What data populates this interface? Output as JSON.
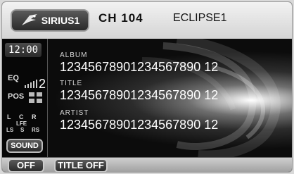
{
  "header": {
    "source_button": {
      "label": "SIRIUS1",
      "icon": "sirius-dog-icon"
    },
    "channel": "CH 104",
    "channel_name": "ECLIPSE1"
  },
  "sidebar": {
    "clock": "12:00",
    "eq_label": "EQ",
    "eq_value": "2",
    "pos_label": "POS",
    "balance": {
      "l": "L",
      "c": "C",
      "r": "R",
      "lfe": "LFE",
      "ls": "LS",
      "s": "S",
      "rs": "RS"
    },
    "sound_button": "SOUND"
  },
  "fields": {
    "album": {
      "label": "ALBUM",
      "value": "12345678901234567890 12"
    },
    "title": {
      "label": "TITLE",
      "value": "12345678901234567890 12"
    },
    "artist": {
      "label": "ARTIST",
      "value": "12345678901234567890 12"
    }
  },
  "footer": {
    "off_button": "OFF",
    "title_off_button": "TITLE OFF"
  }
}
